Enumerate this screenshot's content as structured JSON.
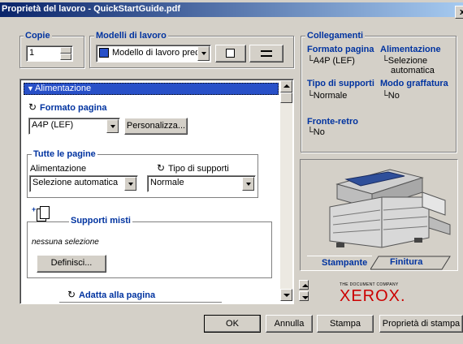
{
  "window": {
    "title": "Proprietà del lavoro - QuickStartGuide.pdf",
    "close_glyph": "x"
  },
  "copies": {
    "label": "Copie",
    "value": "1"
  },
  "models": {
    "label": "Modelli di lavoro",
    "selected": "Modello di lavoro prede"
  },
  "panel": {
    "header": "Alimentazione",
    "formato": {
      "label": "Formato pagina",
      "value": "A4P (LEF)",
      "button": "Personalizza..."
    },
    "tutte": {
      "label": "Tutte le pagine",
      "alimentazione_label": "Alimentazione",
      "alimentazione_value": "Selezione automatica",
      "tipo_label": "Tipo di supporti",
      "tipo_value": "Normale"
    },
    "misti": {
      "label": "Supporti misti",
      "status": "nessuna selezione",
      "button": "Definisci..."
    },
    "adatta": {
      "label": "Adatta alla pagina"
    }
  },
  "links": {
    "title": "Collegamenti",
    "formato": {
      "label": "Formato pagina",
      "value": "A4P (LEF)"
    },
    "alimentazione": {
      "label": "Alimentazione",
      "value1": "Selezione",
      "value2": "automatica"
    },
    "tipo": {
      "label": "Tipo di supporti",
      "value": "Normale"
    },
    "graffatura": {
      "label": "Modo graffatura",
      "value": "No"
    },
    "fronte": {
      "label": "Fronte-retro",
      "value": "No"
    }
  },
  "printer": {
    "tab_active": "Stampante",
    "tab_other": "Finitura",
    "brand_small": "THE DOCUMENT COMPANY",
    "brand": "XEROX."
  },
  "buttons": {
    "ok": "OK",
    "annulla": "Annulla",
    "stampa": "Stampa",
    "proprieta": "Proprietà di stampa"
  },
  "colors": {
    "title_start": "#0a246a",
    "title_end": "#a6caf0",
    "accent": "#0033a0",
    "xerox": "#cc0000",
    "panel_header": "#2850c8"
  }
}
